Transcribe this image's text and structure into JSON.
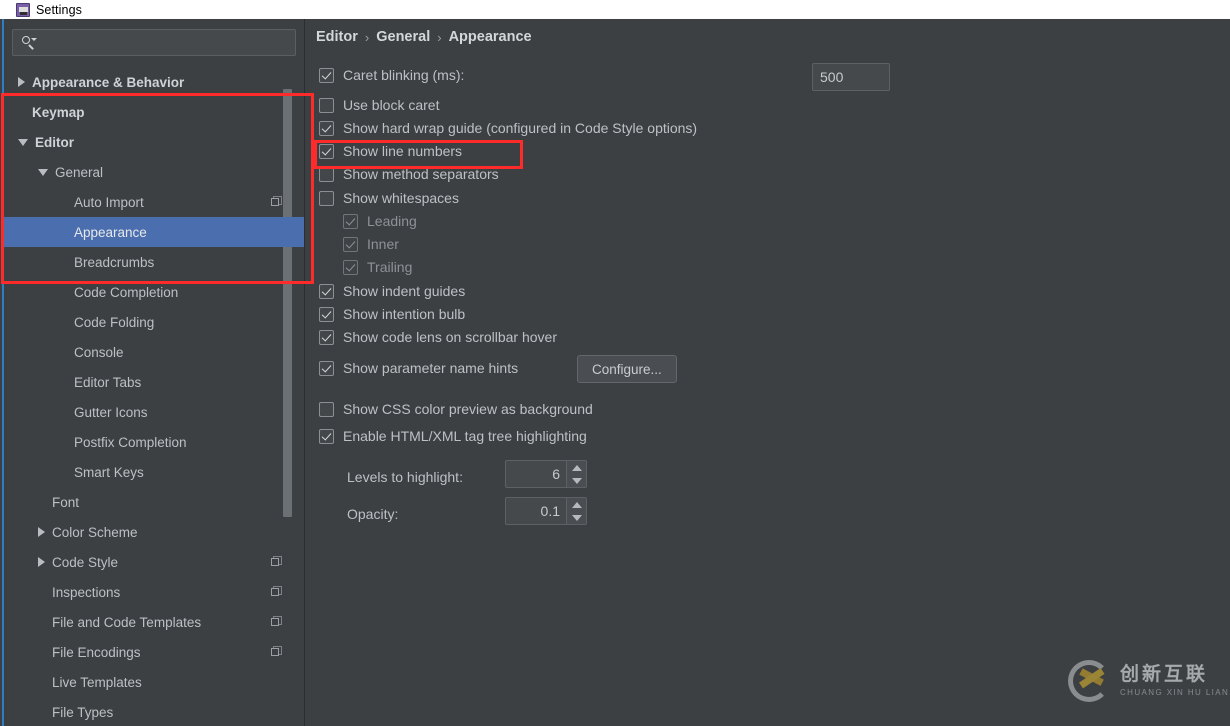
{
  "window": {
    "title": "Settings",
    "icon": "settings-app-icon"
  },
  "sidebar": {
    "search": {
      "value": "",
      "placeholder": "",
      "icon": "search-icon"
    },
    "items": [
      {
        "label": "Appearance & Behavior",
        "indent": 0,
        "arrow": "right",
        "bold": true,
        "selected": false,
        "copy": false
      },
      {
        "label": "Keymap",
        "indent": 0,
        "arrow": "none",
        "bold": true,
        "selected": false,
        "copy": false
      },
      {
        "label": "Editor",
        "indent": 0,
        "arrow": "down",
        "bold": true,
        "selected": false,
        "copy": false
      },
      {
        "label": "General",
        "indent": 1,
        "arrow": "down",
        "bold": false,
        "selected": false,
        "copy": false
      },
      {
        "label": "Auto Import",
        "indent": 2,
        "arrow": "none",
        "bold": false,
        "selected": false,
        "copy": true
      },
      {
        "label": "Appearance",
        "indent": 2,
        "arrow": "none",
        "bold": false,
        "selected": true,
        "copy": false
      },
      {
        "label": "Breadcrumbs",
        "indent": 2,
        "arrow": "none",
        "bold": false,
        "selected": false,
        "copy": false
      },
      {
        "label": "Code Completion",
        "indent": 2,
        "arrow": "none",
        "bold": false,
        "selected": false,
        "copy": false
      },
      {
        "label": "Code Folding",
        "indent": 2,
        "arrow": "none",
        "bold": false,
        "selected": false,
        "copy": false
      },
      {
        "label": "Console",
        "indent": 2,
        "arrow": "none",
        "bold": false,
        "selected": false,
        "copy": false
      },
      {
        "label": "Editor Tabs",
        "indent": 2,
        "arrow": "none",
        "bold": false,
        "selected": false,
        "copy": false
      },
      {
        "label": "Gutter Icons",
        "indent": 2,
        "arrow": "none",
        "bold": false,
        "selected": false,
        "copy": false
      },
      {
        "label": "Postfix Completion",
        "indent": 2,
        "arrow": "none",
        "bold": false,
        "selected": false,
        "copy": false
      },
      {
        "label": "Smart Keys",
        "indent": 2,
        "arrow": "none",
        "bold": false,
        "selected": false,
        "copy": false
      },
      {
        "label": "Font",
        "indent": 1,
        "arrow": "none",
        "bold": false,
        "selected": false,
        "copy": false
      },
      {
        "label": "Color Scheme",
        "indent": 1,
        "arrow": "right",
        "bold": false,
        "selected": false,
        "copy": false
      },
      {
        "label": "Code Style",
        "indent": 1,
        "arrow": "right",
        "bold": false,
        "selected": false,
        "copy": true
      },
      {
        "label": "Inspections",
        "indent": 1,
        "arrow": "none",
        "bold": false,
        "selected": false,
        "copy": true
      },
      {
        "label": "File and Code Templates",
        "indent": 1,
        "arrow": "none",
        "bold": false,
        "selected": false,
        "copy": true
      },
      {
        "label": "File Encodings",
        "indent": 1,
        "arrow": "none",
        "bold": false,
        "selected": false,
        "copy": true
      },
      {
        "label": "Live Templates",
        "indent": 1,
        "arrow": "none",
        "bold": false,
        "selected": false,
        "copy": false
      },
      {
        "label": "File Types",
        "indent": 1,
        "arrow": "none",
        "bold": false,
        "selected": false,
        "copy": false
      }
    ]
  },
  "main": {
    "breadcrumb": [
      "Editor",
      "General",
      "Appearance"
    ],
    "breadcrumb_separator": "›",
    "options": {
      "caret_blinking_label": "Caret blinking (ms):",
      "caret_blinking_value": "500",
      "use_block_caret": "Use block caret",
      "show_hard_wrap_guide": "Show hard wrap guide (configured in Code Style options)",
      "show_line_numbers": "Show line numbers",
      "show_method_separators": "Show method separators",
      "show_whitespaces": "Show whitespaces",
      "leading": "Leading",
      "inner": "Inner",
      "trailing": "Trailing",
      "show_indent_guides": "Show indent guides",
      "show_intention_bulb": "Show intention bulb",
      "show_code_lens": "Show code lens on scrollbar hover",
      "show_parameter_name_hints": "Show parameter name hints",
      "configure_button": "Configure...",
      "show_css_color_preview": "Show CSS color preview as background",
      "enable_tag_tree_highlighting": "Enable HTML/XML tag tree highlighting",
      "levels_to_highlight_label": "Levels to highlight:",
      "levels_to_highlight_value": "6",
      "opacity_label": "Opacity:",
      "opacity_value": "0.1"
    }
  },
  "watermark": {
    "cn": "创新互联",
    "en": "CHUANG XIN HU LIAN"
  },
  "colors": {
    "background": "#3c4043",
    "selection": "#4b6eaf",
    "annotation": "#ff2a2a",
    "accent_blue": "#2f7ec4"
  }
}
